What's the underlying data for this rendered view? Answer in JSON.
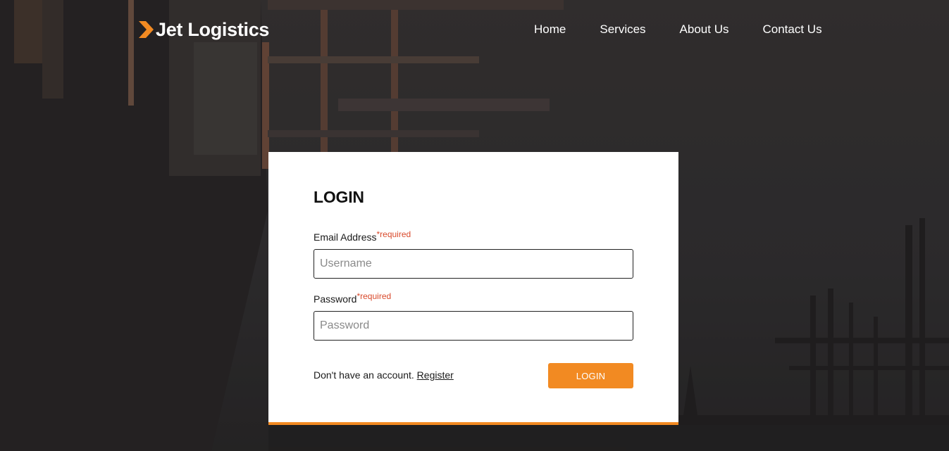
{
  "brand": {
    "name": "Jet Logistics",
    "accent_color": "#f28a22"
  },
  "nav": {
    "items": [
      "Home",
      "Services",
      "About Us",
      "Contact Us"
    ]
  },
  "login": {
    "title": "LOGIN",
    "email": {
      "label": "Email Address",
      "required_text": "*required",
      "placeholder": "Username",
      "value": ""
    },
    "password": {
      "label": "Password",
      "required_text": "*required",
      "placeholder": "Password",
      "value": ""
    },
    "register_prompt": "Don't have an account.",
    "register_link": "Register",
    "submit_label": "LOGIN"
  },
  "icons": {
    "brand_mark": "chevron-right-icon"
  }
}
